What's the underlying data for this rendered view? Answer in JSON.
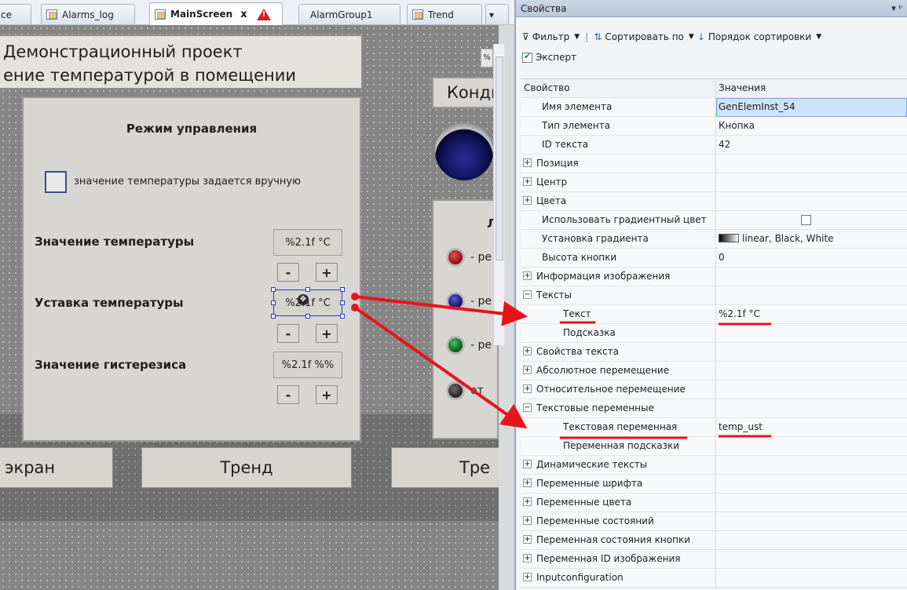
{
  "editor": {
    "tabs": [
      {
        "label": "ce",
        "icon": "none"
      },
      {
        "label": "Alarms_log",
        "icon": "screen-icon"
      },
      {
        "label": "MainScreen",
        "icon": "screen-icon",
        "active": true,
        "close": "x"
      },
      {
        "label": "AlarmGroup1",
        "icon": "alarm-icon"
      },
      {
        "label": "Trend",
        "icon": "screen-icon"
      }
    ],
    "tab_dropdown": "▾",
    "canvas": {
      "title_line1": "Демонстрационный проект",
      "title_line2": "ение температурой в помещении",
      "mode_panel": {
        "title": "Режим управления",
        "manual_checkbox_label": "значение температуры задается вручную",
        "temp_value_label": "Значение температуры",
        "temp_value_text": "%2.1f °C",
        "setpoint_label": "Уставка температуры",
        "setpoint_text": "%2.1f °C",
        "hysteresis_label": "Значение гистерезиса",
        "hysteresis_text": "%2.1f %%",
        "minus": "-",
        "plus": "+"
      },
      "nav_buttons": [
        "экран",
        "Тренд",
        "Тре"
      ],
      "right_button": "Конди",
      "legend": {
        "title": "Ле",
        "items": [
          {
            "label": "- ре",
            "color": "#a3121a"
          },
          {
            "label": "- ре",
            "color": "#1a1a7a"
          },
          {
            "label": "- ре",
            "color": "#0e6b1e"
          },
          {
            "label": "от",
            "color": "#2e2e2e"
          }
        ]
      },
      "zoom_button": "%"
    }
  },
  "properties": {
    "title": "Свойства",
    "pin": "▾ ᵖ",
    "toolbar": {
      "filter": "Фильтр",
      "sort_by": "Сортировать по",
      "sort_order": "Порядок сортировки"
    },
    "expert": "Эксперт",
    "columns": {
      "property": "Свойство",
      "values": "Значения"
    },
    "rows": [
      {
        "name": "Имя элемента",
        "value": "GenElemInst_54",
        "level": 1,
        "selected": true
      },
      {
        "name": "Тип элемента",
        "value": "Кнопка",
        "level": 1
      },
      {
        "name": "ID текста",
        "value": "42",
        "level": 1
      },
      {
        "name": "Позиция",
        "value": "",
        "level": 0,
        "expander": "+"
      },
      {
        "name": "Центр",
        "value": "",
        "level": 0,
        "expander": "+"
      },
      {
        "name": "Цвета",
        "value": "",
        "level": 0,
        "expander": "+"
      },
      {
        "name": "Использовать градиентный цвет",
        "value": "",
        "level": 1,
        "checkbox": true
      },
      {
        "name": "Установка градиента",
        "value": "linear, Black, White",
        "level": 1,
        "swatch": true
      },
      {
        "name": "Высота кнопки",
        "value": "0",
        "level": 1
      },
      {
        "name": "Информация изображения",
        "value": "",
        "level": 0,
        "expander": "+"
      },
      {
        "name": "Тексты",
        "value": "",
        "level": 0,
        "expander": "−"
      },
      {
        "name": "Текст",
        "value": "%2.1f °C",
        "level": 2
      },
      {
        "name": "Подсказка",
        "value": "",
        "level": 2
      },
      {
        "name": "Свойства текста",
        "value": "",
        "level": 0,
        "expander": "+"
      },
      {
        "name": "Абсолютное перемещение",
        "value": "",
        "level": 0,
        "expander": "+"
      },
      {
        "name": "Относительное перемещение",
        "value": "",
        "level": 0,
        "expander": "+"
      },
      {
        "name": "Текстовые переменные",
        "value": "",
        "level": 0,
        "expander": "−"
      },
      {
        "name": "Текстовая переменная",
        "value": "temp_ust",
        "level": 2
      },
      {
        "name": "Переменная подсказки",
        "value": "",
        "level": 2
      },
      {
        "name": "Динамические тексты",
        "value": "",
        "level": 0,
        "expander": "+"
      },
      {
        "name": "Переменные шрифта",
        "value": "",
        "level": 0,
        "expander": "+"
      },
      {
        "name": "Переменные цвета",
        "value": "",
        "level": 0,
        "expander": "+"
      },
      {
        "name": "Переменные состояний",
        "value": "",
        "level": 0,
        "expander": "+"
      },
      {
        "name": "Переменная состояния кнопки",
        "value": "",
        "level": 0,
        "expander": "+"
      },
      {
        "name": "Переменная ID изображения",
        "value": "",
        "level": 0,
        "expander": "+"
      },
      {
        "name": "Inputconfiguration",
        "value": "",
        "level": 0,
        "expander": "+"
      }
    ]
  },
  "annotation_color": "#e8141b"
}
